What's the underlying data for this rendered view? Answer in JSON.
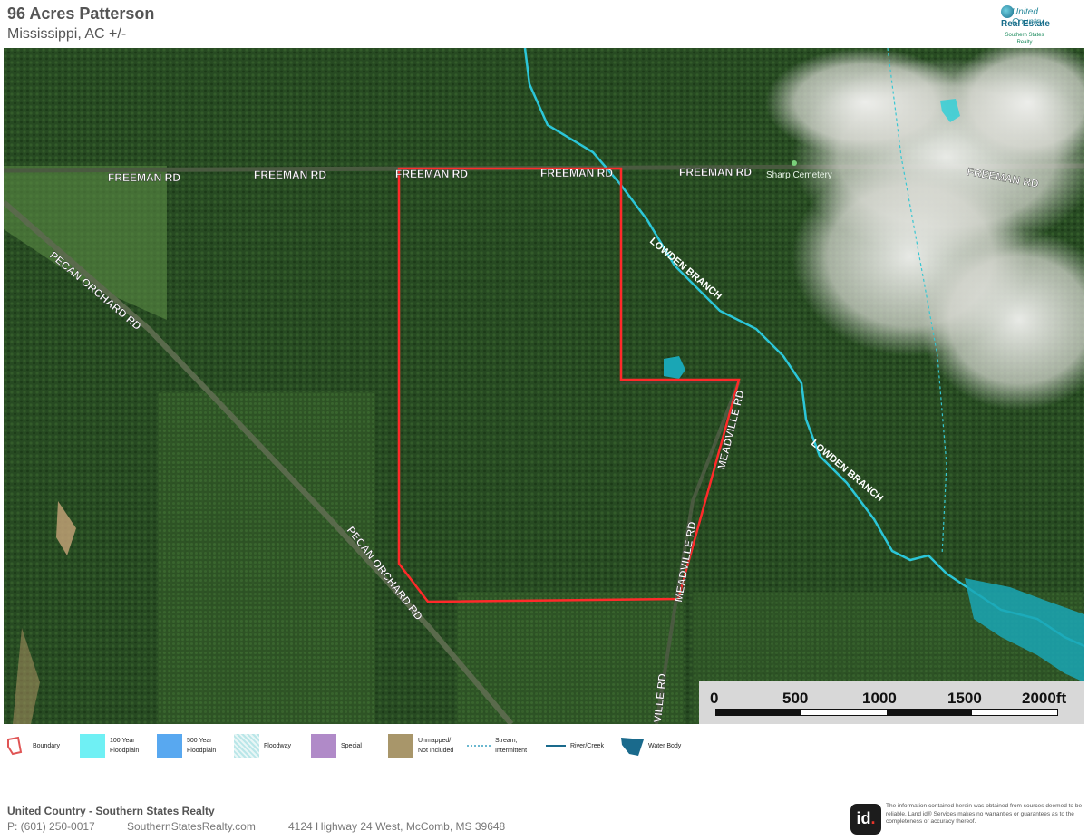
{
  "header": {
    "title": "96 Acres Patterson",
    "subtitle": "Mississippi,  AC +/-"
  },
  "logo": {
    "brand_top": "United Country",
    "brand_main": "Real Estate",
    "brand_sub": "Southern States Realty"
  },
  "map": {
    "road_labels": {
      "freeman_1": "FREEMAN RD",
      "freeman_2": "FREEMAN RD",
      "freeman_3": "FREEMAN RD",
      "freeman_4": "FREEMAN RD",
      "freeman_5": "FREEMAN RD",
      "freeman_6": "FREEMAN RD",
      "pecan_1": "PECAN ORCHARD RD",
      "pecan_2": "PECAN ORCHARD RD",
      "meadville_1": "MEADVILLE RD",
      "meadville_2": "MEADVILLE RD",
      "meadville_3": "VILLE RD",
      "lowden_1": "LOWDEN BRANCH",
      "lowden_2": "LOWDEN BRANCH"
    },
    "place_labels": {
      "cemetery": "Sharp Cemetery"
    },
    "boundary_color": "#ff2a2a",
    "river_color": "#2cc6d8",
    "water_body_color": "#1aa6b5"
  },
  "scale": {
    "labels": [
      "0",
      "500",
      "1000",
      "1500",
      "2000ft"
    ]
  },
  "legend": {
    "items": [
      {
        "label": "Boundary",
        "color": "#e05555"
      },
      {
        "label": "100 Year\nFloodplain",
        "color": "#6ff0f4"
      },
      {
        "label": "500 Year\nFloodplain",
        "color": "#58a8f0"
      },
      {
        "label": "Floodway",
        "color": "#b9e6e8"
      },
      {
        "label": "Special",
        "color": "#b08ac8"
      },
      {
        "label": "Unmapped/\nNot Included",
        "color": "#a8966a"
      },
      {
        "label": "Stream,\nIntermittent",
        "color": "#3aa0c0"
      },
      {
        "label": "River/Creek",
        "color": "#1a6a8c"
      },
      {
        "label": "Water Body",
        "color": "#1a6a8c"
      }
    ]
  },
  "footer": {
    "company": "United Country - Southern States Realty",
    "phone": "P: (601) 250-0017",
    "website": "SouthernStatesRealty.com",
    "address": "4124 Highway 24 West, McComb, MS 39648",
    "id_logo": "id",
    "disclaimer": "The information contained herein was obtained from sources deemed to be reliable. Land id® Services makes no warranties or guarantees as to the completeness or accuracy thereof."
  }
}
